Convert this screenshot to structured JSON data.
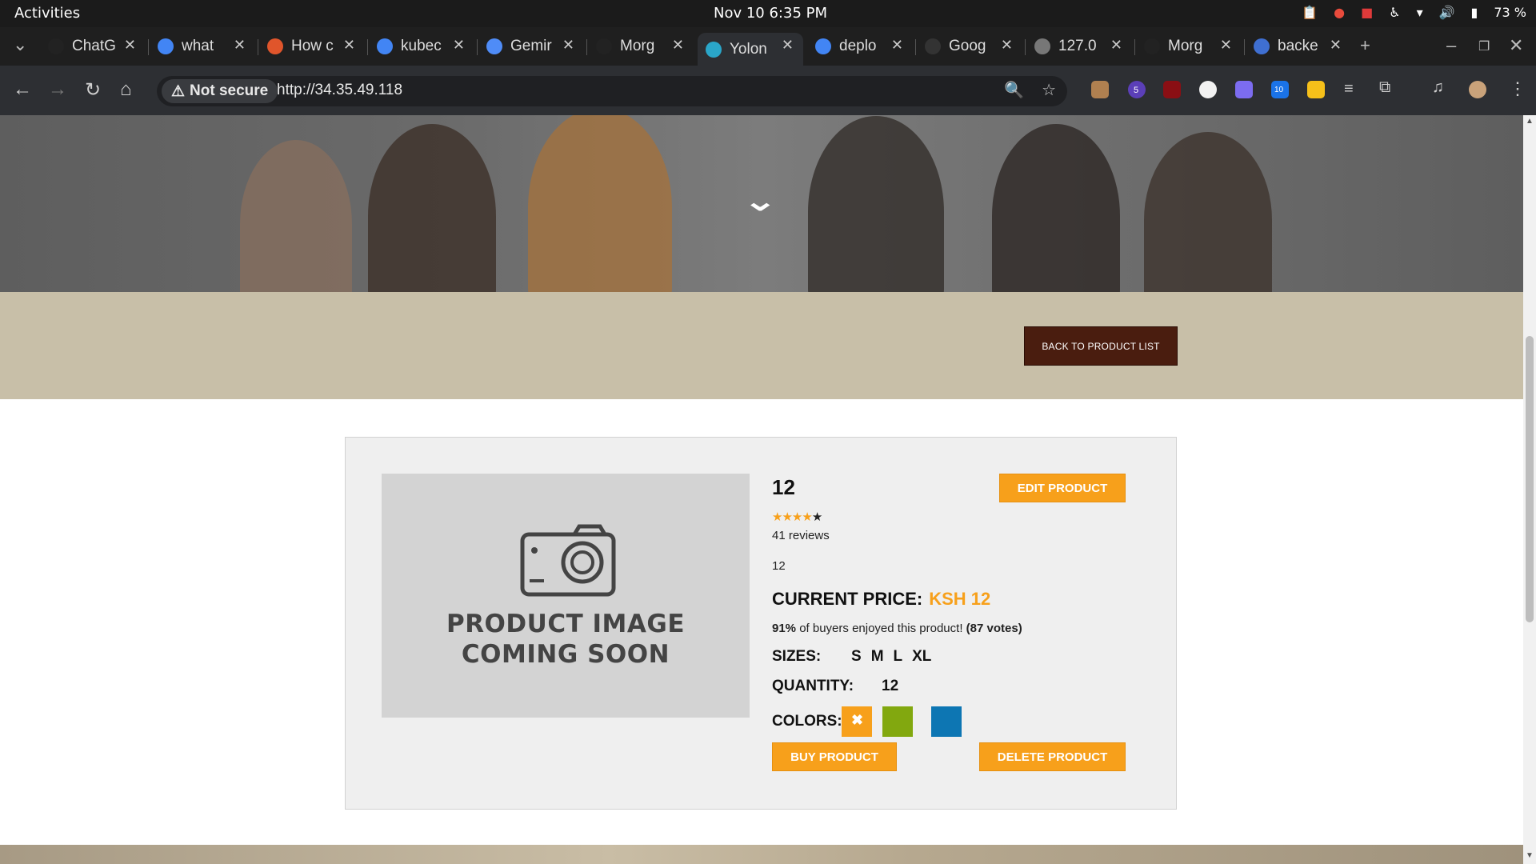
{
  "system_bar": {
    "activities": "Activities",
    "datetime": "Nov 10   6:35 PM",
    "battery": "73 %"
  },
  "tabs": [
    {
      "label": "ChatG",
      "icon": "chatgpt-icon",
      "color": "#222222"
    },
    {
      "label": "what",
      "icon": "google-icon",
      "color": "#4285f4"
    },
    {
      "label": "How c",
      "icon": "ask-icon",
      "color": "#e0552b"
    },
    {
      "label": "kubec",
      "icon": "google-icon",
      "color": "#4285f4"
    },
    {
      "label": "Gemir",
      "icon": "gemini-icon",
      "color": "#4f8cf7"
    },
    {
      "label": "Morg",
      "icon": "github-icon",
      "color": "#222222"
    },
    {
      "label": "Yolon",
      "icon": "react-icon",
      "color": "#2aa6c9",
      "active": true
    },
    {
      "label": "deplo",
      "icon": "google-icon",
      "color": "#4285f4"
    },
    {
      "label": "Goog",
      "icon": "blank-icon",
      "color": "#333333"
    },
    {
      "label": "127.0",
      "icon": "globe-icon",
      "color": "#777777"
    },
    {
      "label": "Morg",
      "icon": "github-icon",
      "color": "#222222"
    },
    {
      "label": "backe",
      "icon": "hex-icon",
      "color": "#3f6fd1"
    }
  ],
  "toolbar": {
    "security_label": "Not secure",
    "url": "http://34.35.49.118",
    "extension_badge": "5",
    "calendar_ext": "10"
  },
  "page": {
    "back_button": "BACK TO PRODUCT LIST",
    "product": {
      "name": "12",
      "rating": 4,
      "rating_max": 5,
      "reviews": "41 reviews",
      "description": "12",
      "price_label": "CURRENT PRICE:",
      "price_value": "KSH 12",
      "enjoy_percent": "91%",
      "enjoy_text": " of buyers enjoyed this product! ",
      "enjoy_votes": "(87 votes)",
      "sizes_label": "SIZES:",
      "sizes": [
        "S",
        "M",
        "L",
        "XL"
      ],
      "quantity_label": "QUANTITY:",
      "quantity": "12",
      "colors_label": "COLORS:",
      "colors": [
        "#f7a01b",
        "#82a80f",
        "#0d76b3"
      ],
      "image_placeholder_line1": "PRODUCT IMAGE",
      "image_placeholder_line2": "COMING SOON",
      "edit_button": "EDIT PRODUCT",
      "buy_button": "BUY PRODUCT",
      "delete_button": "DELETE PRODUCT"
    }
  }
}
